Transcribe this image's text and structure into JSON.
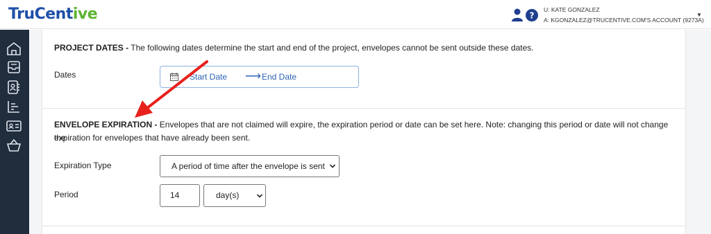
{
  "header": {
    "logo_part1": "TruCent",
    "logo_part2": "ive",
    "user_line": "U: KATE GONZALEZ",
    "account_line": "A: KGONZALEZ@TRUCENTIVE.COM'S ACCOUNT (9273A)"
  },
  "sidebar": {
    "icons": [
      "home-icon",
      "inbox-icon",
      "contacts-icon",
      "list-icon",
      "id-card-icon",
      "basket-icon"
    ]
  },
  "project_dates": {
    "heading": "PROJECT DATES -",
    "description": " The following dates determine the start and end of the project, envelopes cannot be sent outside these dates.",
    "dates_label": "Dates",
    "start_placeholder": "Start Date",
    "end_placeholder": "End Date"
  },
  "expiration": {
    "heading": "ENVELOPE EXPIRATION -",
    "description_line1": " Envelopes that are not claimed will expire, the expiration period or date can be set here. Note: changing this period or date will not change the",
    "description_line2": "expiration for envelopes that have already been sent.",
    "type_label": "Expiration Type",
    "type_value": "A period of time after the envelope is sent",
    "period_label": "Period",
    "period_value": "14",
    "period_unit": "day(s)"
  },
  "colors": {
    "sidebar": "#1f2d3d",
    "logo_blue": "#1f4fa8",
    "logo_green": "#5cb531",
    "accent_blue": "#2c63b5",
    "annotation_red": "#e8211d"
  }
}
